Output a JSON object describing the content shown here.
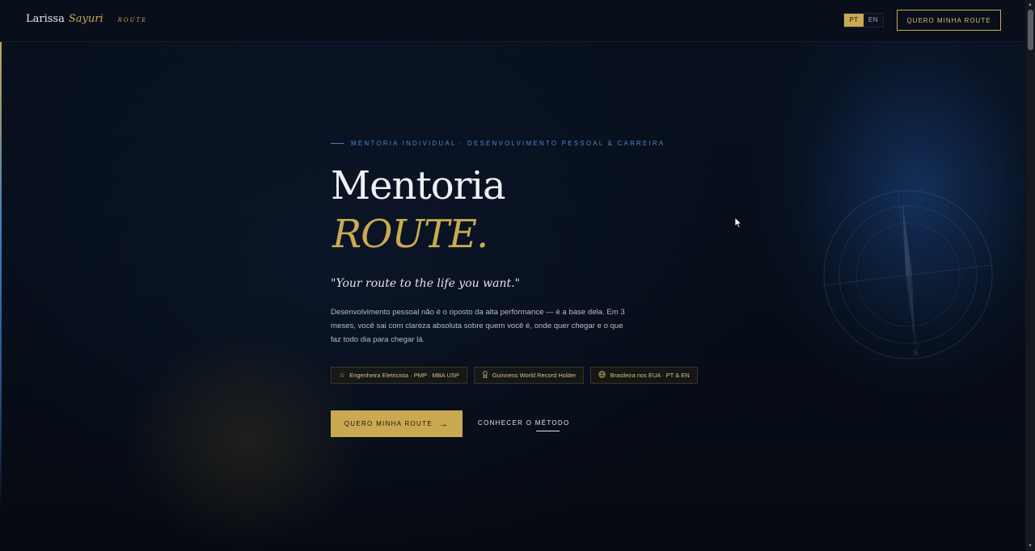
{
  "header": {
    "brand_first": "Larissa",
    "brand_last": "Sayuri",
    "brand_tag": "ROUTE",
    "lang_pt": "PT",
    "lang_en": "EN",
    "cta_label": "QUERO MINHA ROUTE"
  },
  "hero": {
    "eyebrow": "MENTORIA INDIVIDUAL · DESENVOLVIMENTO PESSOAL & CARREIRA",
    "title_line1": "Mentoria",
    "title_line2": "ROUTE.",
    "quote": "\"Your route to the life you want.\"",
    "description": "Desenvolvimento pessoal não é o oposto da alta performance — é a base dela. Em 3 meses, você sai com clareza absoluta sobre quem você é, onde quer chegar e o que faz todo dia para chegar lá.",
    "badges": [
      {
        "icon": "star-icon",
        "text": "Engenheira Eletricista · PMP · MBA USP"
      },
      {
        "icon": "award-icon",
        "text": "Guinness World Record Holder"
      },
      {
        "icon": "globe-icon",
        "text": "Brasileira nos EUA · PT & EN"
      }
    ],
    "primary_cta": "QUERO MINHA ROUTE",
    "secondary_cta": "CONHECER O MÉTODO",
    "compass_label": "S"
  },
  "colors": {
    "background": "#070c16",
    "gold": "#c9aa52",
    "blue_accent": "#4e84c6"
  }
}
